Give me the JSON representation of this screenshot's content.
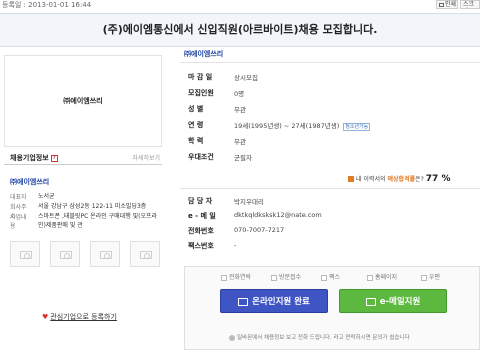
{
  "top": {
    "date_label": "등록일 : 2013-01-01 16:44",
    "print_label": "인쇄",
    "scrap_label": "스크랩"
  },
  "title": "(주)에이엠통신에서 신입직원(아르바이트)채용 모집합니다.",
  "left": {
    "logo_text": "㈜에이엠쓰리",
    "info_heading": "채용기업정보",
    "info_more": "자세히보기",
    "company_name": "㈜에이엠쓰리",
    "rows": [
      {
        "k": "대표자",
        "v": "노서균"
      },
      {
        "k": "회사주소",
        "v": "서울 강남구 삼성2동 122-11 미소빌딩3층"
      },
      {
        "k": "사업내용",
        "v": "스마트폰 ,태블릿PC 온라인 구매대행 및(오프라인)제품판매 및 관"
      }
    ],
    "favorite_label": "관심기업으로 등록하기"
  },
  "right": {
    "company_title": "㈜에이엠쓰리",
    "fields": [
      {
        "k": "마 감 일",
        "v": "상시모집"
      },
      {
        "k": "모집인원",
        "v": "0명"
      },
      {
        "k": "성 별",
        "v": "무관"
      },
      {
        "k": "연 령",
        "v": "19세(1995년생) ~ 27세(1987년생)"
      },
      {
        "k": "학 력",
        "v": "무관"
      },
      {
        "k": "우대조건",
        "v": "군필자"
      }
    ],
    "age_badge": "청소년가능",
    "rate_text_prefix": "내 이력서의",
    "rate_text_bold": "예상합격률",
    "rate_text_suffix": "은?",
    "rate_value": "77",
    "rate_unit": "%",
    "contacts": [
      {
        "k": "담 당 자",
        "v": "박지우대리"
      },
      {
        "k": "e - 메 일",
        "v": "dktkqldksksk12@nate.com"
      },
      {
        "k": "전화번호",
        "v": "070-7007-7217"
      },
      {
        "k": "팩스번호",
        "v": "-"
      }
    ],
    "checks": [
      "전화연락",
      "방문접수",
      "팩스",
      "홈페이지",
      "우편"
    ],
    "online_button": "온라인지원 완료",
    "email_button": "e-메일지원",
    "notice": "일바몬에서 채용정보 보고 전화 드립니다. 라고 연락하시면 문의가 쉽습니다"
  },
  "colors": {
    "accent_blue": "#3f55c4",
    "accent_green": "#5cb83e",
    "rate_orange": "#e07b26"
  }
}
